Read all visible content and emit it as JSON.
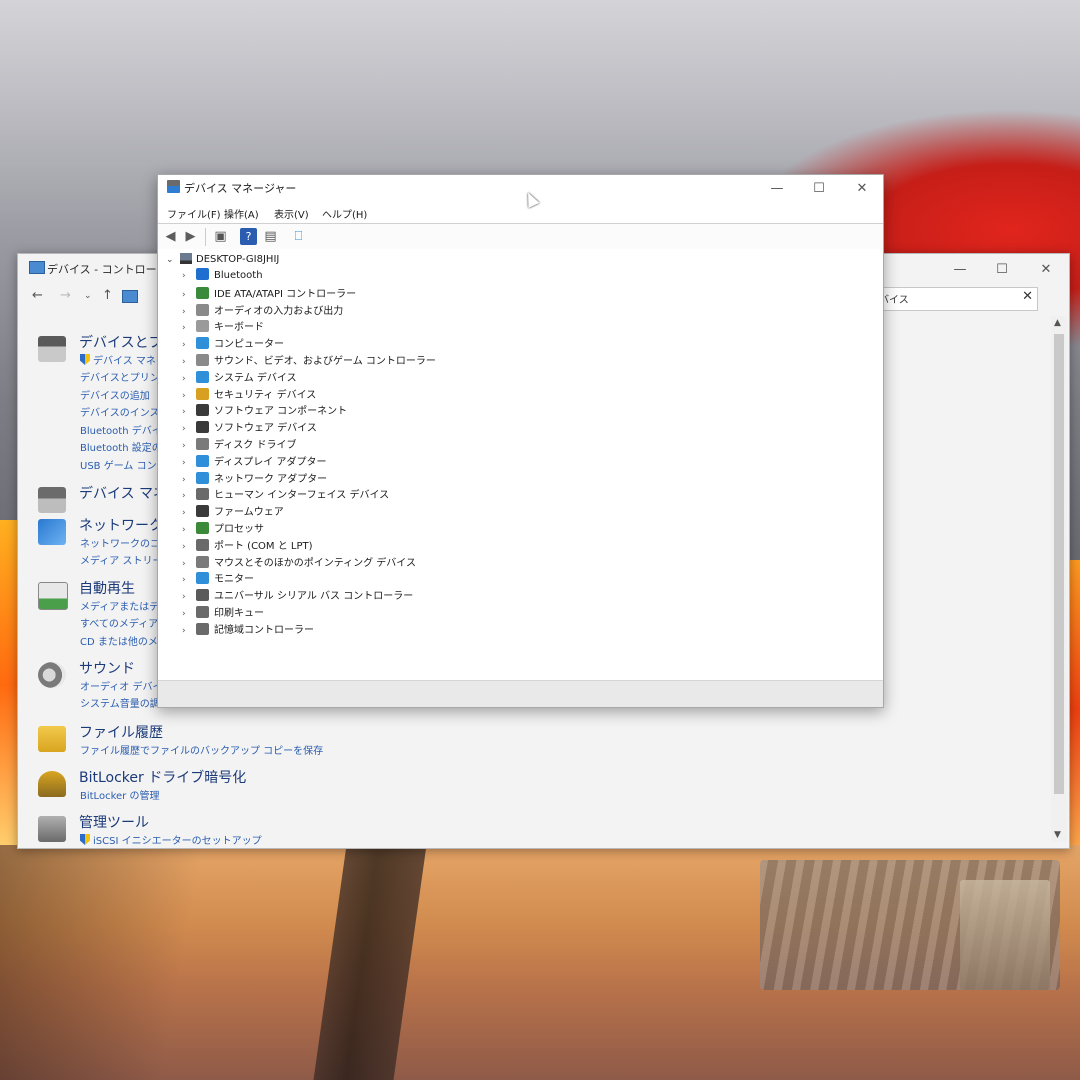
{
  "control_panel": {
    "title": "デバイス - コントロール パ",
    "search_value": "デバイス",
    "categories": [
      {
        "title": "デバイスとプリ",
        "links": [
          "デバイス マネー",
          "デバイスとプリンタ",
          "デバイスの追加",
          "デバイスのインスト",
          "Bluetooth デバイ",
          "Bluetooth 設定の",
          "USB ゲーム コント"
        ]
      },
      {
        "title": "デバイス マネー",
        "links": []
      },
      {
        "title": "ネットワークと",
        "links": [
          "ネットワークのコンピ",
          "メディア ストリーミ"
        ]
      },
      {
        "title": "自動再生",
        "links": [
          "メディアまたはデバ",
          "すべてのメディアと",
          "CD または他のメ"
        ]
      },
      {
        "title": "サウンド",
        "links": [
          "オーディオ デバイス",
          "システム音量の調整"
        ]
      },
      {
        "title": "ファイル履歴",
        "links": [
          "ファイル履歴でファイルのバックアップ コピーを保存"
        ]
      },
      {
        "title": "BitLocker ドライブ暗号化",
        "links": [
          "BitLocker の管理"
        ]
      },
      {
        "title": "管理ツール",
        "links": [
          "iSCSI イニシエーターのセットアップ"
        ]
      }
    ]
  },
  "device_manager": {
    "title": "デバイス マネージャー",
    "menu": [
      "ファイル(F)",
      "操作(A)",
      "表示(V)",
      "ヘルプ(H)"
    ],
    "root": "DESKTOP-GI8JHIJ",
    "devices": [
      {
        "label": "Bluetooth",
        "icon": "bluetooth-icon",
        "color": "#1f6fd1"
      },
      {
        "label": "IDE ATA/ATAPI コントローラー",
        "icon": "ide-controller-icon",
        "color": "#3b8a3b"
      },
      {
        "label": "オーディオの入力および出力",
        "icon": "speaker-icon",
        "color": "#8a8a8a"
      },
      {
        "label": "キーボード",
        "icon": "keyboard-icon",
        "color": "#9a9a9a"
      },
      {
        "label": "コンピューター",
        "icon": "computer-icon",
        "color": "#2f8fd8"
      },
      {
        "label": "サウンド、ビデオ、およびゲーム コントローラー",
        "icon": "speaker-icon",
        "color": "#8a8a8a"
      },
      {
        "label": "システム デバイス",
        "icon": "system-device-icon",
        "color": "#2f8fd8"
      },
      {
        "label": "セキュリティ デバイス",
        "icon": "security-device-icon",
        "color": "#d8a020"
      },
      {
        "label": "ソフトウェア コンポーネント",
        "icon": "software-component-icon",
        "color": "#3a3a3a"
      },
      {
        "label": "ソフトウェア デバイス",
        "icon": "software-device-icon",
        "color": "#3a3a3a"
      },
      {
        "label": "ディスク ドライブ",
        "icon": "disk-drive-icon",
        "color": "#7a7a7a"
      },
      {
        "label": "ディスプレイ アダプター",
        "icon": "display-adapter-icon",
        "color": "#2f8fd8"
      },
      {
        "label": "ネットワーク アダプター",
        "icon": "network-adapter-icon",
        "color": "#2f8fd8"
      },
      {
        "label": "ヒューマン インターフェイス デバイス",
        "icon": "hid-icon",
        "color": "#6a6a6a"
      },
      {
        "label": "ファームウェア",
        "icon": "firmware-icon",
        "color": "#3a3a3a"
      },
      {
        "label": "プロセッサ",
        "icon": "processor-icon",
        "color": "#3a8a3a"
      },
      {
        "label": "ポート (COM と LPT)",
        "icon": "port-icon",
        "color": "#6a6a6a"
      },
      {
        "label": "マウスとそのほかのポインティング デバイス",
        "icon": "mouse-icon",
        "color": "#7a7a7a"
      },
      {
        "label": "モニター",
        "icon": "monitor-icon",
        "color": "#2f8fd8"
      },
      {
        "label": "ユニバーサル シリアル バス コントローラー",
        "icon": "usb-icon",
        "color": "#5a5a5a"
      },
      {
        "label": "印刷キュー",
        "icon": "printer-icon",
        "color": "#6a6a6a"
      },
      {
        "label": "記憶域コントローラー",
        "icon": "storage-controller-icon",
        "color": "#6a6a6a"
      }
    ]
  }
}
